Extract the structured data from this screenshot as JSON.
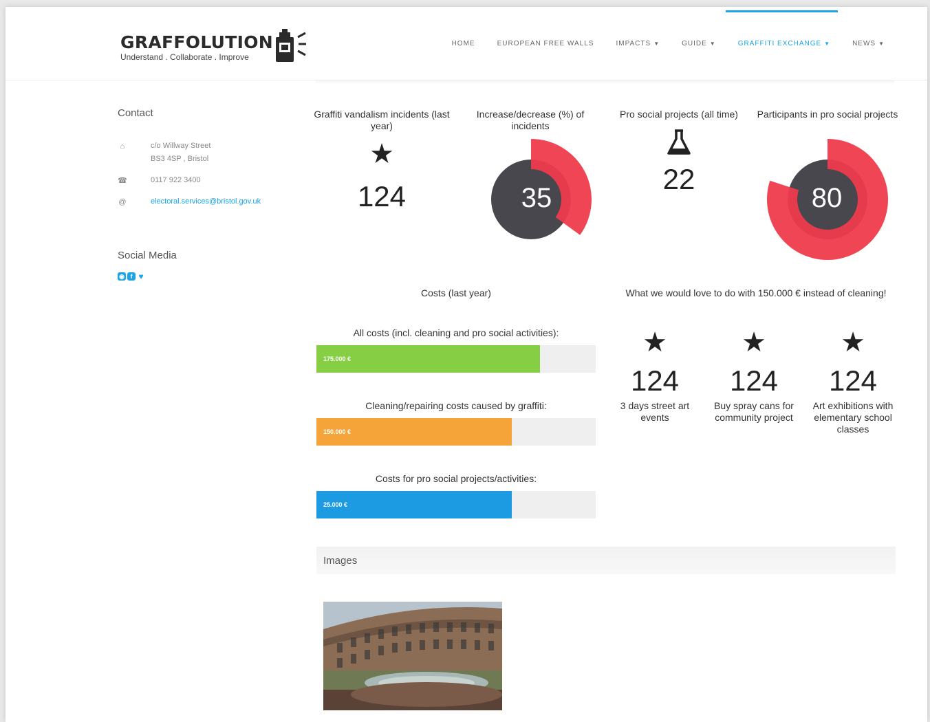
{
  "brand": {
    "name": "GRAFFOLUTION",
    "tagline": "Understand . Collaborate . Improve"
  },
  "nav": [
    {
      "label": "HOME",
      "caret": false,
      "active": false
    },
    {
      "label": "EUROPEAN FREE WALLS",
      "caret": false,
      "active": false
    },
    {
      "label": "IMPACTS",
      "caret": true,
      "active": false
    },
    {
      "label": "GUIDE",
      "caret": true,
      "active": false
    },
    {
      "label": "GRAFFITI EXCHANGE",
      "caret": true,
      "active": true
    },
    {
      "label": "NEWS",
      "caret": true,
      "active": false
    }
  ],
  "sidebar": {
    "contact_title": "Contact",
    "address_line1": "c/o Willway Street",
    "address_line2": "BS3 4SP , Bristol",
    "phone": "0117 922 3400",
    "email": "electoral.services@bristol.gov.uk",
    "social_title": "Social Media"
  },
  "stats": {
    "incidents": {
      "label": "Graffiti vandalism incidents (last year)",
      "value": "124",
      "icon": "star-icon"
    },
    "change": {
      "label": "Increase/decrease (%) of incidents",
      "value": "35",
      "percent": 35
    },
    "projects": {
      "label": "Pro social projects (all time)",
      "value": "22",
      "icon": "flask-icon"
    },
    "participants": {
      "label": "Participants in pro social projects",
      "value": "80",
      "percent": 80
    }
  },
  "costs": {
    "title": "Costs (last year)",
    "items": [
      {
        "label": "All costs (incl. cleaning and pro social activities):",
        "value": "175.000 €",
        "fraction": 0.8,
        "color": "#86cf45"
      },
      {
        "label": "Cleaning/repairing costs caused by graffiti:",
        "value": "150.000 €",
        "fraction": 0.7,
        "color": "#f5a43a"
      },
      {
        "label": "Costs for pro social projects/activities:",
        "value": "25.000 €",
        "fraction": 0.7,
        "color": "#1c9be3"
      }
    ]
  },
  "love": {
    "title": "What we would love to do with 150.000 € instead of cleaning!",
    "items": [
      {
        "value": "124",
        "desc": "3 days street art events"
      },
      {
        "value": "124",
        "desc": "Buy spray cans for community project"
      },
      {
        "value": "124",
        "desc": "Art exhibitions with elementary school classes"
      }
    ]
  },
  "images": {
    "title": "Images"
  },
  "colors": {
    "accent": "#1aa3e8",
    "ring_red": "#ef3b4c",
    "ring_dark": "#47474d"
  }
}
